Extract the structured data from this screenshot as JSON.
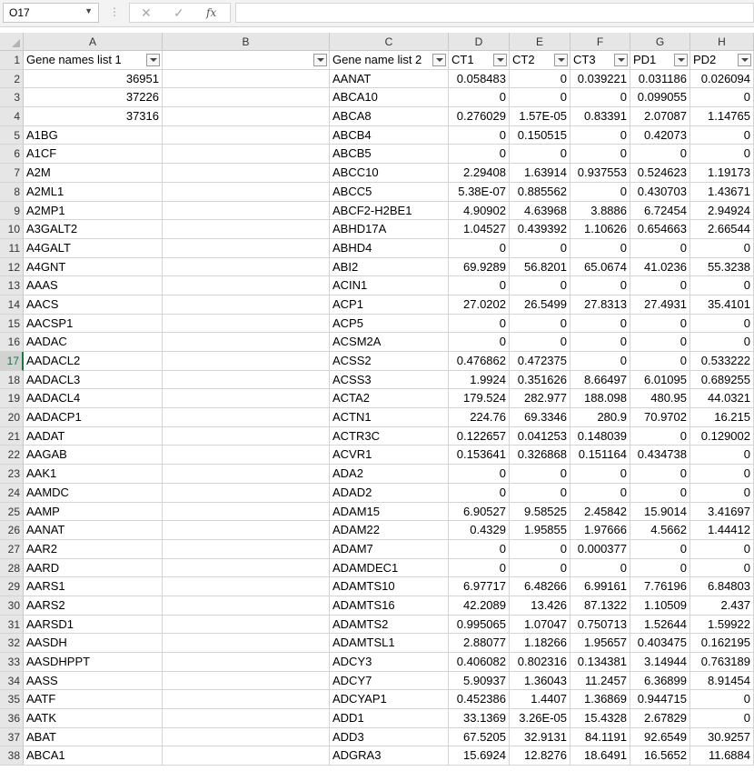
{
  "formula_bar": {
    "name_box": "O17",
    "fx_label": "fx",
    "formula": ""
  },
  "selected_row": 17,
  "columns": [
    {
      "letter": "A",
      "width": 153
    },
    {
      "letter": "B",
      "width": 184
    },
    {
      "letter": "C",
      "width": 131
    },
    {
      "letter": "D",
      "width": 67
    },
    {
      "letter": "E",
      "width": 67
    },
    {
      "letter": "F",
      "width": 66
    },
    {
      "letter": "G",
      "width": 66
    },
    {
      "letter": "H",
      "width": 70
    }
  ],
  "header_row": [
    "Gene names list 1",
    "",
    "Gene name list 2",
    "CT1",
    "CT2",
    "CT3",
    "PD1",
    "PD2"
  ],
  "rows": [
    [
      "36951",
      "",
      "AANAT",
      "0.058483",
      "0",
      "0.039221",
      "0.031186",
      "0.026094"
    ],
    [
      "37226",
      "",
      "ABCA10",
      "0",
      "0",
      "0",
      "0.099055",
      "0"
    ],
    [
      "37316",
      "",
      "ABCA8",
      "0.276029",
      "1.57E-05",
      "0.83391",
      "2.07087",
      "1.14765"
    ],
    [
      "A1BG",
      "",
      "ABCB4",
      "0",
      "0.150515",
      "0",
      "0.42073",
      "0"
    ],
    [
      "A1CF",
      "",
      "ABCB5",
      "0",
      "0",
      "0",
      "0",
      "0"
    ],
    [
      "A2M",
      "",
      "ABCC10",
      "2.29408",
      "1.63914",
      "0.937553",
      "0.524623",
      "1.19173"
    ],
    [
      "A2ML1",
      "",
      "ABCC5",
      "5.38E-07",
      "0.885562",
      "0",
      "0.430703",
      "1.43671"
    ],
    [
      "A2MP1",
      "",
      "ABCF2-H2BE1",
      "4.90902",
      "4.63968",
      "3.8886",
      "6.72454",
      "2.94924"
    ],
    [
      "A3GALT2",
      "",
      "ABHD17A",
      "1.04527",
      "0.439392",
      "1.10626",
      "0.654663",
      "2.66544"
    ],
    [
      "A4GALT",
      "",
      "ABHD4",
      "0",
      "0",
      "0",
      "0",
      "0"
    ],
    [
      "A4GNT",
      "",
      "ABI2",
      "69.9289",
      "56.8201",
      "65.0674",
      "41.0236",
      "55.3238"
    ],
    [
      "AAAS",
      "",
      "ACIN1",
      "0",
      "0",
      "0",
      "0",
      "0"
    ],
    [
      "AACS",
      "",
      "ACP1",
      "27.0202",
      "26.5499",
      "27.8313",
      "27.4931",
      "35.4101"
    ],
    [
      "AACSP1",
      "",
      "ACP5",
      "0",
      "0",
      "0",
      "0",
      "0"
    ],
    [
      "AADAC",
      "",
      "ACSM2A",
      "0",
      "0",
      "0",
      "0",
      "0"
    ],
    [
      "AADACL2",
      "",
      "ACSS2",
      "0.476862",
      "0.472375",
      "0",
      "0",
      "0.533222"
    ],
    [
      "AADACL3",
      "",
      "ACSS3",
      "1.9924",
      "0.351626",
      "8.66497",
      "6.01095",
      "0.689255"
    ],
    [
      "AADACL4",
      "",
      "ACTA2",
      "179.524",
      "282.977",
      "188.098",
      "480.95",
      "44.0321"
    ],
    [
      "AADACP1",
      "",
      "ACTN1",
      "224.76",
      "69.3346",
      "280.9",
      "70.9702",
      "16.215"
    ],
    [
      "AADAT",
      "",
      "ACTR3C",
      "0.122657",
      "0.041253",
      "0.148039",
      "0",
      "0.129002"
    ],
    [
      "AAGAB",
      "",
      "ACVR1",
      "0.153641",
      "0.326868",
      "0.151164",
      "0.434738",
      "0"
    ],
    [
      "AAK1",
      "",
      "ADA2",
      "0",
      "0",
      "0",
      "0",
      "0"
    ],
    [
      "AAMDC",
      "",
      "ADAD2",
      "0",
      "0",
      "0",
      "0",
      "0"
    ],
    [
      "AAMP",
      "",
      "ADAM15",
      "6.90527",
      "9.58525",
      "2.45842",
      "15.9014",
      "3.41697"
    ],
    [
      "AANAT",
      "",
      "ADAM22",
      "0.4329",
      "1.95855",
      "1.97666",
      "4.5662",
      "1.44412"
    ],
    [
      "AAR2",
      "",
      "ADAM7",
      "0",
      "0",
      "0.000377",
      "0",
      "0"
    ],
    [
      "AARD",
      "",
      "ADAMDEC1",
      "0",
      "0",
      "0",
      "0",
      "0"
    ],
    [
      "AARS1",
      "",
      "ADAMTS10",
      "6.97717",
      "6.48266",
      "6.99161",
      "7.76196",
      "6.84803"
    ],
    [
      "AARS2",
      "",
      "ADAMTS16",
      "42.2089",
      "13.426",
      "87.1322",
      "1.10509",
      "2.437"
    ],
    [
      "AARSD1",
      "",
      "ADAMTS2",
      "0.995065",
      "1.07047",
      "0.750713",
      "1.52644",
      "1.59922"
    ],
    [
      "AASDH",
      "",
      "ADAMTSL1",
      "2.88077",
      "1.18266",
      "1.95657",
      "0.403475",
      "0.162195"
    ],
    [
      "AASDHPPT",
      "",
      "ADCY3",
      "0.406082",
      "0.802316",
      "0.134381",
      "3.14944",
      "0.763189"
    ],
    [
      "AASS",
      "",
      "ADCY7",
      "5.90937",
      "1.36043",
      "11.2457",
      "6.36899",
      "8.91454"
    ],
    [
      "AATF",
      "",
      "ADCYAP1",
      "0.452386",
      "1.4407",
      "1.36869",
      "0.944715",
      "0"
    ],
    [
      "AATK",
      "",
      "ADD1",
      "33.1369",
      "3.26E-05",
      "15.4328",
      "2.67829",
      "0"
    ],
    [
      "ABAT",
      "",
      "ADD3",
      "67.5205",
      "32.9131",
      "84.1191",
      "92.6549",
      "30.9257"
    ],
    [
      "ABCA1",
      "",
      "ADGRA3",
      "15.6924",
      "12.8276",
      "18.6491",
      "16.5652",
      "11.6884"
    ]
  ]
}
